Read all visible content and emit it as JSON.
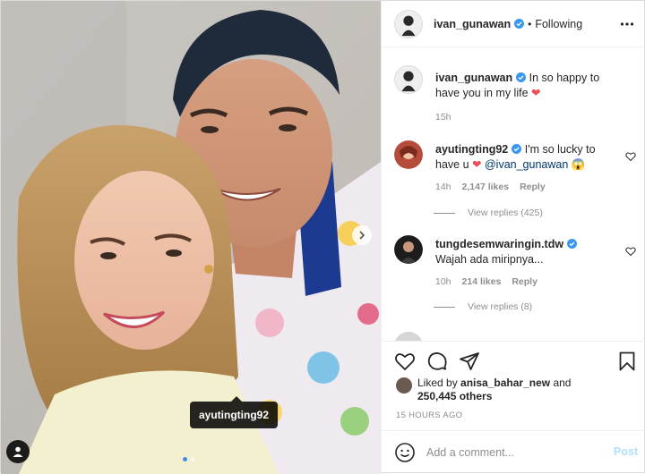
{
  "post": {
    "author": "ivan_gunawan",
    "follow_separator": "•",
    "follow_status": "Following",
    "photo_tag": "ayutingting92",
    "carousel_total": 2,
    "carousel_active": 1
  },
  "caption": {
    "username": "ivan_gunawan",
    "text": "In so happy to have you in my life",
    "emoji": "❤",
    "time": "15h"
  },
  "comments": [
    {
      "username": "ayutingting92",
      "text_before": "I'm so lucky to have u",
      "emoji": "❤",
      "mention": "@ivan_gunawan",
      "emoji2": "😱",
      "time": "14h",
      "likes": "2,147 likes",
      "reply": "Reply",
      "view_replies": "View replies (425)"
    },
    {
      "username": "tungdesemwaringin.tdw",
      "text": "Wajah ada miripnya...",
      "time": "10h",
      "likes": "214 likes",
      "reply": "Reply",
      "view_replies": "View replies (8)"
    }
  ],
  "likes": {
    "prefix": "Liked by",
    "liker": "anisa_bahar_new",
    "and": "and",
    "count": "250,445 others"
  },
  "posted_time": "15 HOURS AGO",
  "add_comment": {
    "placeholder": "Add a comment...",
    "post_label": "Post"
  },
  "colors": {
    "heart": "#ed4956",
    "verified": "#3897f0",
    "link": "#00376b",
    "post_disabled": "#b2dffc",
    "meta": "#8e8e8e"
  },
  "icons": [
    "more-options-icon",
    "verified-badge-icon",
    "like-heart-icon",
    "comment-icon",
    "share-icon",
    "bookmark-icon",
    "emoji-icon",
    "next-arrow-icon",
    "user-tag-icon"
  ]
}
